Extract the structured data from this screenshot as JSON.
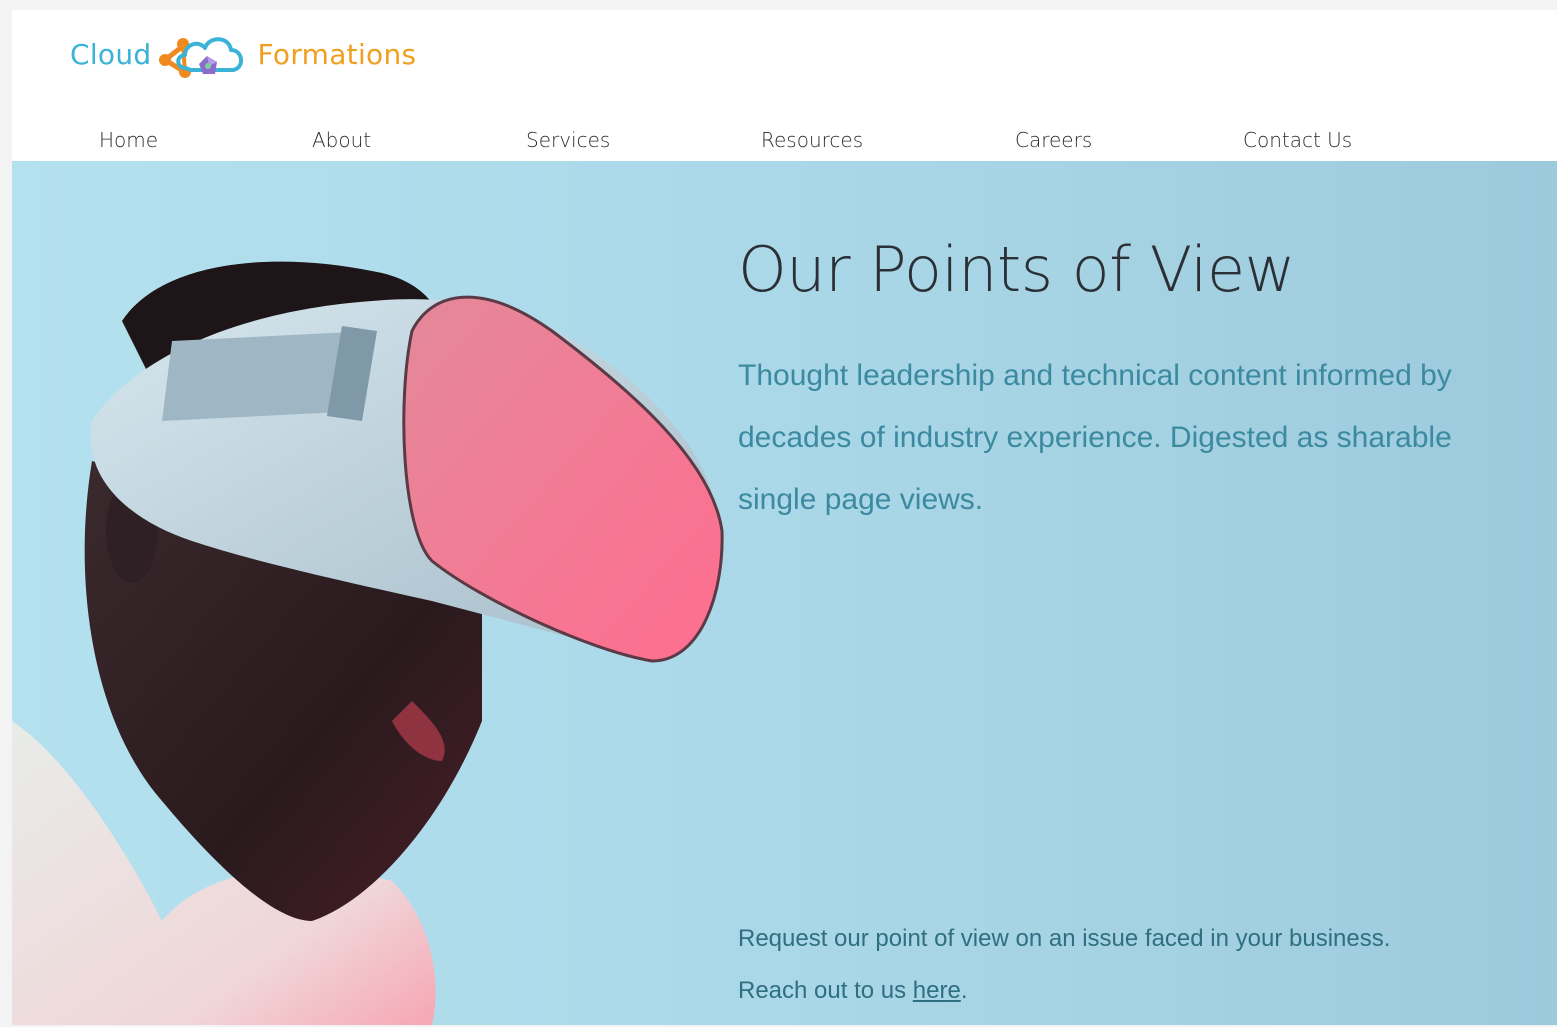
{
  "logo": {
    "word_left": "Cloud",
    "word_right": "Formations",
    "colors": {
      "left": "#3bb3d8",
      "right": "#f0a020"
    },
    "icon": "cloud-network-icon"
  },
  "nav": {
    "items": [
      {
        "label": "Home"
      },
      {
        "label": "About"
      },
      {
        "label": "Services"
      },
      {
        "label": "Resources"
      },
      {
        "label": "Careers"
      },
      {
        "label": "Contact Us"
      }
    ]
  },
  "hero": {
    "title": "Our Points of View",
    "subtitle": "Thought leadership and technical content informed by decades of industry experience. Digested as sharable single page views.",
    "cta_line1": "Request our point of view on an issue faced in your business.",
    "cta_line2_prefix": "Reach out to us ",
    "cta_link": "here",
    "cta_line2_suffix": ".",
    "image": "person-wearing-vr-headset-photo",
    "colors": {
      "background": "#acdaea",
      "headset_visor": "#f0708e",
      "title": "#2a3035",
      "subtitle": "#3b8aa0"
    }
  }
}
